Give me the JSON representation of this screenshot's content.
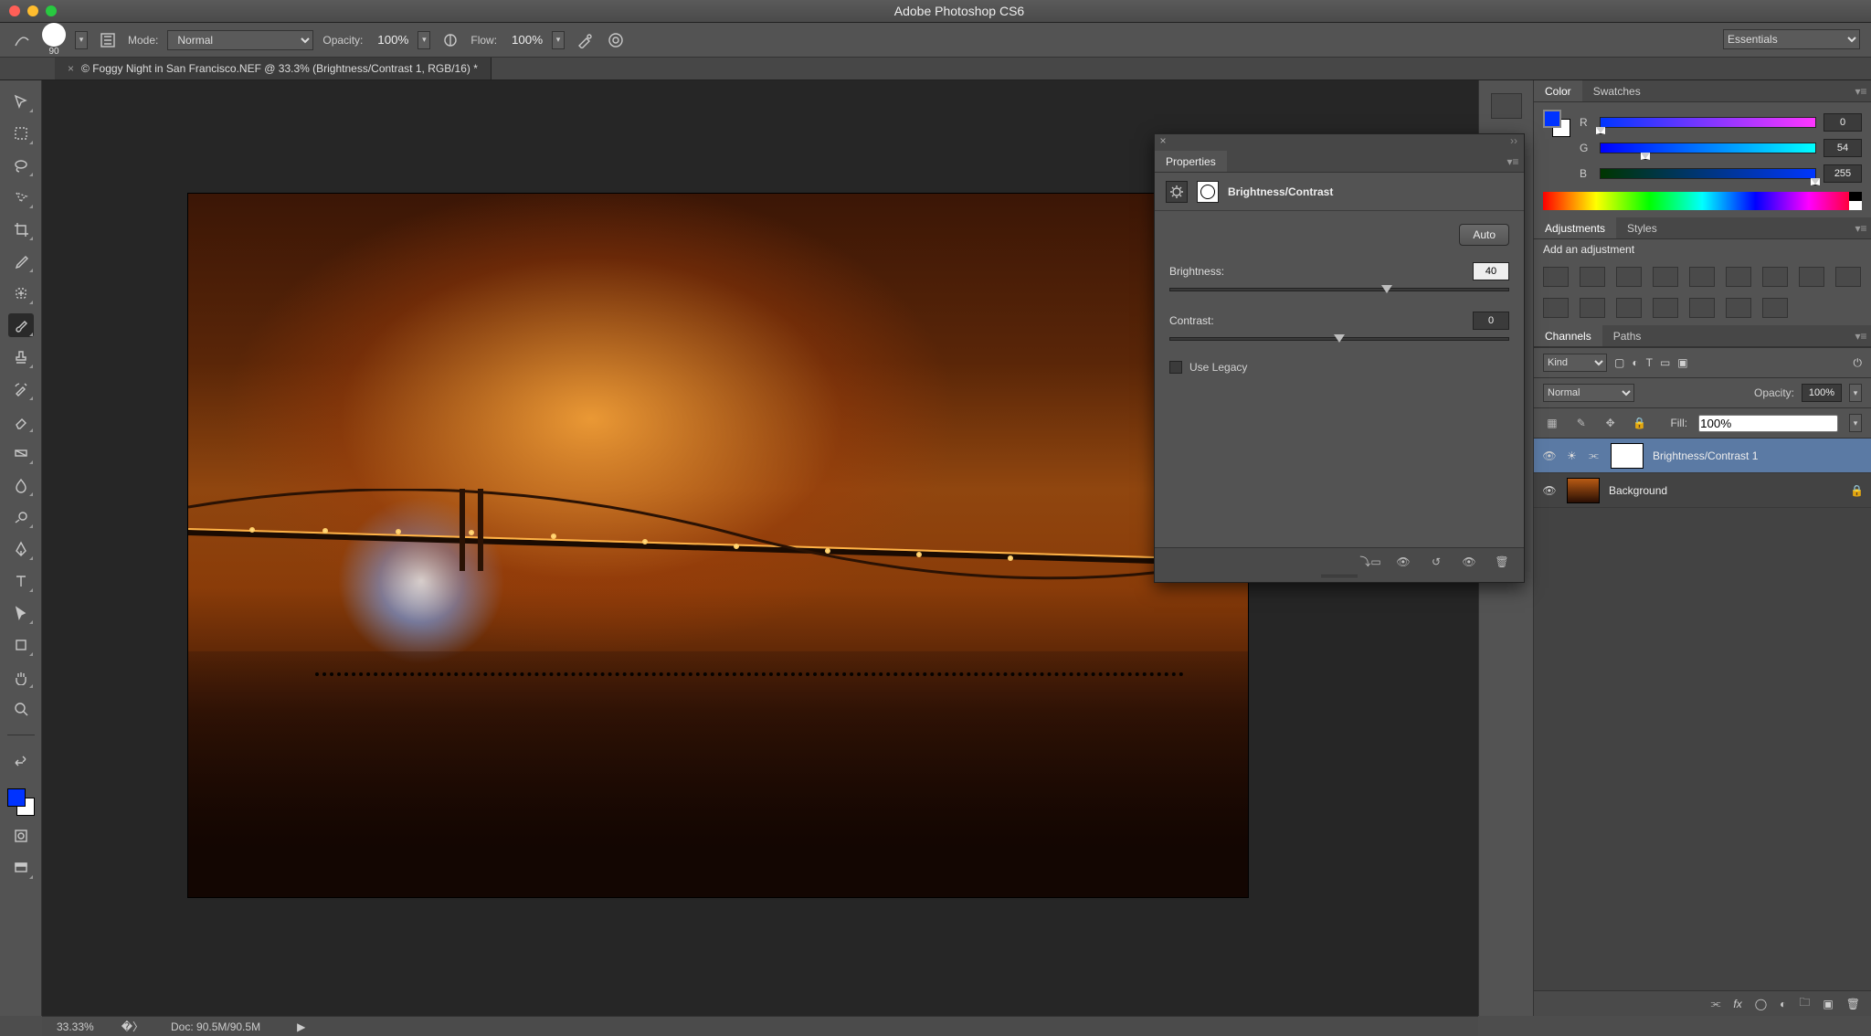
{
  "app": {
    "title": "Adobe Photoshop CS6"
  },
  "workspace": {
    "selected": "Essentials"
  },
  "options": {
    "brush_size": "90",
    "mode_label": "Mode:",
    "mode_value": "Normal",
    "opacity_label": "Opacity:",
    "opacity_value": "100%",
    "flow_label": "Flow:",
    "flow_value": "100%"
  },
  "document": {
    "tab_title": "© Foggy Night in San Francisco.NEF @ 33.3% (Brightness/Contrast 1, RGB/16) *"
  },
  "color_panel": {
    "tabs": [
      "Color",
      "Swatches"
    ],
    "active": "Color",
    "channels": [
      {
        "label": "R",
        "value": "0",
        "pct": 0,
        "grad": "linear-gradient(90deg,#0036ff,#ff36ff)"
      },
      {
        "label": "G",
        "value": "54",
        "pct": 21,
        "grad": "linear-gradient(90deg,#0000ff,#00ffff)"
      },
      {
        "label": "B",
        "value": "255",
        "pct": 100,
        "grad": "linear-gradient(90deg,#003600,#0036ff)"
      }
    ]
  },
  "mid_panel": {
    "tabs": [
      "Adjustments",
      "Styles"
    ],
    "active": "Adjustments",
    "add_label": "Add an adjustment"
  },
  "chan_panel": {
    "tabs": [
      "Channels",
      "Paths"
    ],
    "active": "Channels"
  },
  "layer_opts": {
    "opacity_label": "Opacity:",
    "opacity_value": "100%",
    "fill_label": "Fill:",
    "fill_value": "100%"
  },
  "layers": [
    {
      "name": "Brightness/Contrast 1",
      "selected": true,
      "type": "adj",
      "locked": false
    },
    {
      "name": "Background",
      "selected": false,
      "type": "img",
      "locked": true
    }
  ],
  "properties": {
    "tab": "Properties",
    "kind": "Brightness/Contrast",
    "auto_label": "Auto",
    "brightness_label": "Brightness:",
    "brightness_value": "40",
    "brightness_pct": 64,
    "contrast_label": "Contrast:",
    "contrast_value": "0",
    "contrast_pct": 50,
    "legacy_label": "Use Legacy"
  },
  "status": {
    "zoom": "33.33%",
    "doc": "Doc: 90.5M/90.5M"
  },
  "foreground_color": "#0033ff",
  "background_color": "#ffffff"
}
